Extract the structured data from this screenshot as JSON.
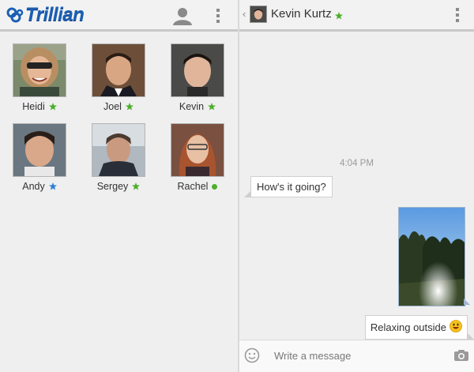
{
  "app": {
    "logo_text": "Trillian",
    "accent": "#1a5fb4",
    "status_colors": {
      "star_green": "#4caf2b",
      "star_blue": "#2f7fd6",
      "online": "#4caf2b"
    }
  },
  "contacts": [
    {
      "name": "Heidi",
      "status": "star-green"
    },
    {
      "name": "Joel",
      "status": "star-green"
    },
    {
      "name": "Kevin",
      "status": "star-green"
    },
    {
      "name": "Andy",
      "status": "star-blue"
    },
    {
      "name": "Sergey",
      "status": "star-green"
    },
    {
      "name": "Rachel",
      "status": "dot-green"
    }
  ],
  "chat": {
    "contact_name": "Kevin Kurtz",
    "contact_status": "star-green",
    "timestamp": "4:04 PM",
    "messages": [
      {
        "direction": "in",
        "text": "How's it going?"
      },
      {
        "direction": "out",
        "type": "photo"
      },
      {
        "direction": "out",
        "text": "Relaxing outside",
        "emoji": "smiley"
      }
    ],
    "composer": {
      "placeholder": "Write a message"
    }
  }
}
